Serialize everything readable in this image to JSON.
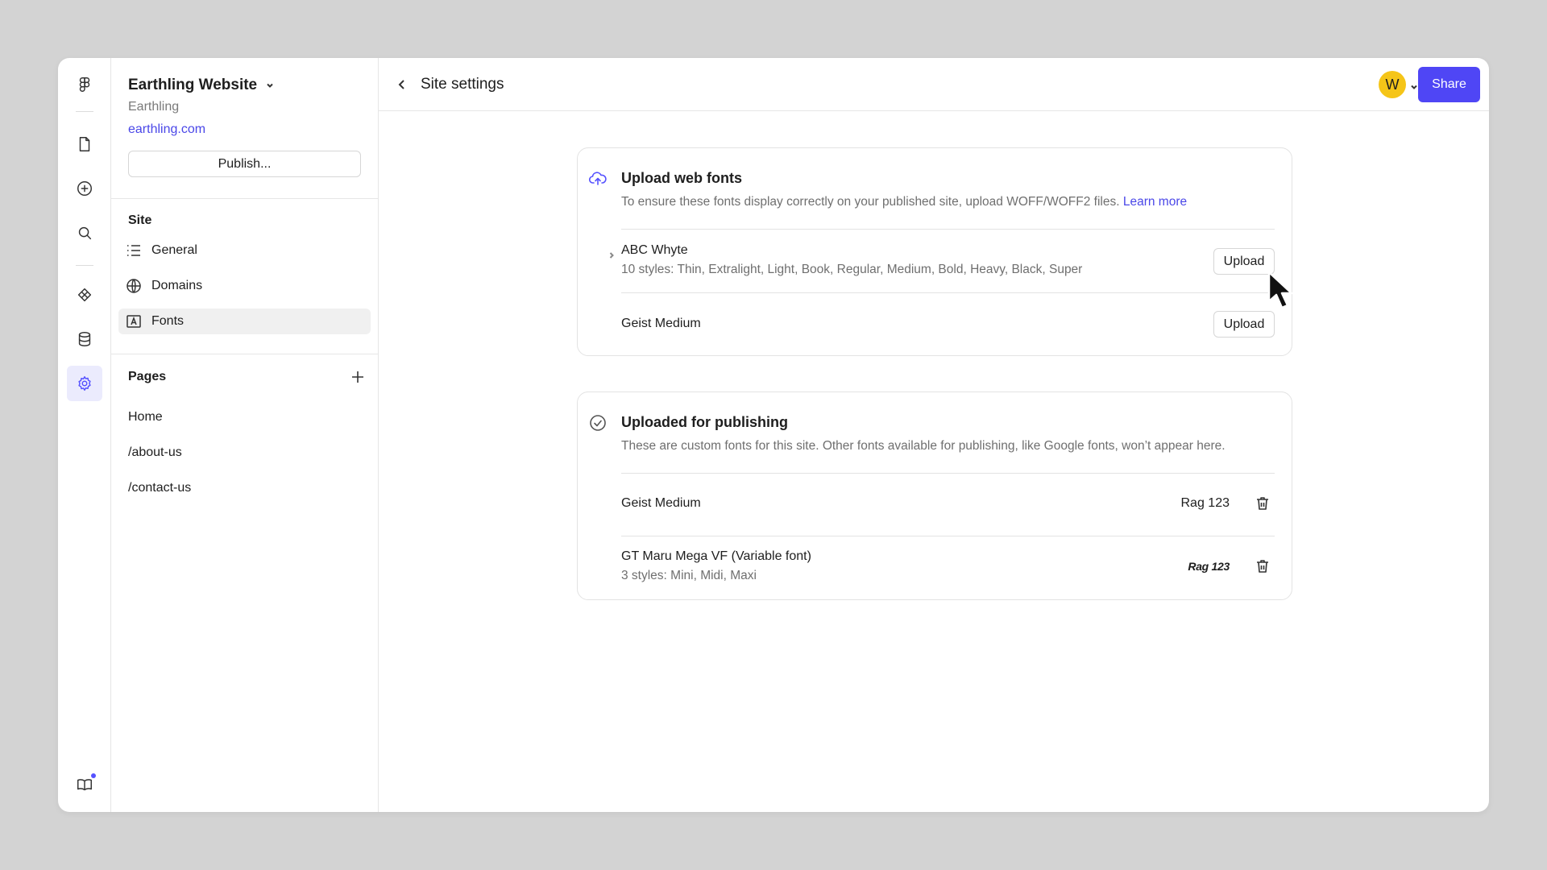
{
  "project": {
    "name": "Earthling Website",
    "team": "Earthling",
    "domain_link": "earthling.com",
    "publish_label": "Publish..."
  },
  "sidebar": {
    "site_section_title": "Site",
    "site_items": [
      {
        "label": "General",
        "icon": "list-icon"
      },
      {
        "label": "Domains",
        "icon": "globe-icon"
      },
      {
        "label": "Fonts",
        "icon": "font-icon",
        "active": true
      }
    ],
    "pages_section_title": "Pages",
    "pages": [
      "Home",
      "/about-us",
      "/contact-us"
    ]
  },
  "header": {
    "title": "Site settings",
    "avatar_initial": "W",
    "share_label": "Share"
  },
  "upload_card": {
    "title": "Upload web fonts",
    "description": "To ensure these fonts display correctly on your published site, upload WOFF/WOFF2 files.",
    "learn_more": "Learn more",
    "fonts": [
      {
        "name": "ABC Whyte",
        "styles": "10 styles: Thin, Extralight, Light, Book, Regular, Medium, Bold, Heavy, Black, Super",
        "action": "Upload"
      },
      {
        "name": "Geist Medium",
        "action": "Upload"
      }
    ]
  },
  "published_card": {
    "title": "Uploaded for publishing",
    "description": "These are custom fonts for this site. Other fonts available for publishing, like Google fonts, won’t appear here.",
    "fonts": [
      {
        "name": "Geist Medium",
        "sample": "Rag 123"
      },
      {
        "name": "GT Maru Mega VF (Variable font)",
        "styles": "3 styles: Mini, Midi, Maxi",
        "sample": "Rag 123"
      }
    ]
  },
  "colors": {
    "accent": "#4f46f5",
    "link": "#4a47e8",
    "avatar": "#f5c518",
    "background": "#d3d3d3"
  }
}
